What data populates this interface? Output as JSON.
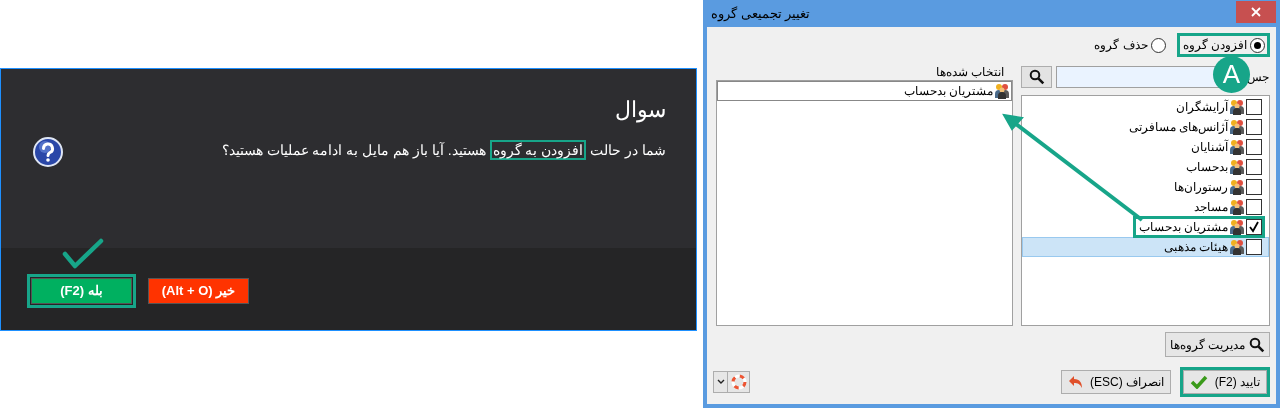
{
  "question_dialog": {
    "title": "سوال",
    "message": [
      {
        "text": "شما در حالت ",
        "highlighted": false
      },
      {
        "text": "افزودن به گروه",
        "highlighted": true
      },
      {
        "text": " هستید. آیا باز هم مایل به ادامه عملیات هستید؟",
        "highlighted": false
      }
    ],
    "buttons": [
      {
        "label": "خیر (Alt + O)",
        "kind": "cancel",
        "highlighted": false
      },
      {
        "label": "بله (F2)",
        "kind": "confirm",
        "highlighted": true
      }
    ]
  },
  "group_window": {
    "title": "تغییر تجمیعی گروه",
    "modes": [
      {
        "label": "افزودن گروه",
        "selected": true,
        "highlighted": true
      },
      {
        "label": "حذف گروه",
        "selected": false,
        "highlighted": false
      }
    ],
    "selected_panel": {
      "title": "انتخاب شده‌ها",
      "items": [
        "مشتریان بدحساب"
      ]
    },
    "search": {
      "label": "جس"
    },
    "groups": [
      {
        "label": "آرایشگران",
        "checked": false,
        "selected": false,
        "highlighted": false
      },
      {
        "label": "آژانس‌های مسافرتی",
        "checked": false,
        "selected": false,
        "highlighted": false
      },
      {
        "label": "آشنایان",
        "checked": false,
        "selected": false,
        "highlighted": false
      },
      {
        "label": "بدحساب",
        "checked": false,
        "selected": false,
        "highlighted": false
      },
      {
        "label": "رستوران‌ها",
        "checked": false,
        "selected": false,
        "highlighted": false
      },
      {
        "label": "مساجد",
        "checked": false,
        "selected": false,
        "highlighted": false
      },
      {
        "label": "مشتریان بدحساب",
        "checked": true,
        "selected": false,
        "highlighted": true
      },
      {
        "label": "هیئات مذهبی",
        "checked": false,
        "selected": true,
        "highlighted": false
      }
    ],
    "manage_button": "مدیریت گروه‌ها",
    "buttons": [
      {
        "label": "تایید (F2)",
        "kind": "confirm",
        "highlighted": true
      },
      {
        "label": "انصراف (ESC)",
        "kind": "cancel",
        "highlighted": false
      }
    ]
  },
  "annotation": {
    "badge": "A"
  }
}
